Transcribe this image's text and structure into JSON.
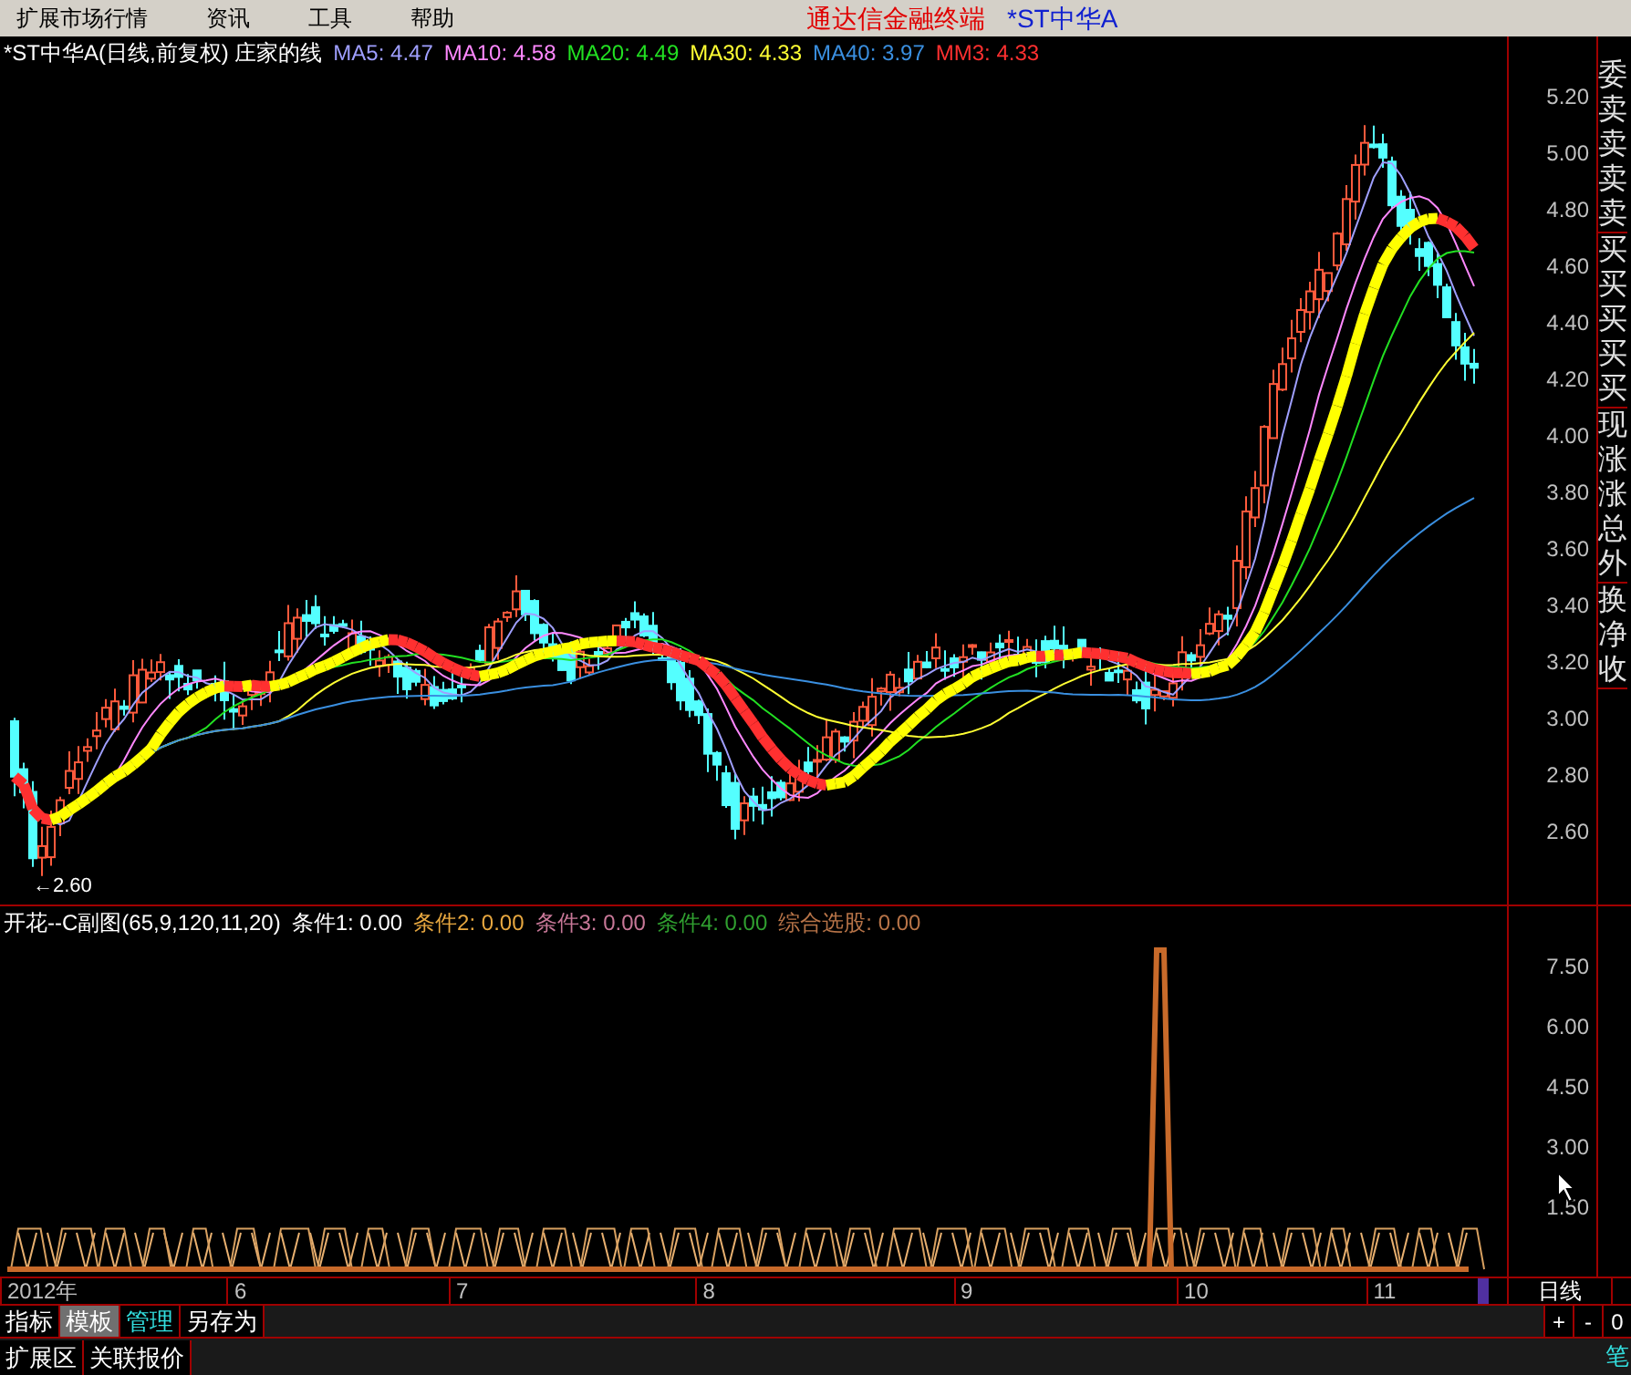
{
  "menu": [
    {
      "label": "扩展市场行情"
    },
    {
      "label": "资讯"
    },
    {
      "label": "工具"
    },
    {
      "label": "帮助"
    }
  ],
  "terminal_title": "通达信金融终端",
  "stock": "*ST中华A",
  "main_chart": {
    "title": "*ST中华A(日线,前复权) 庄家的线",
    "indicators": [
      {
        "label": "MA5: 4.47",
        "color": "#9f9fff"
      },
      {
        "label": "MA10: 4.58",
        "color": "#ff88ff"
      },
      {
        "label": "MA20: 4.49",
        "color": "#22e022"
      },
      {
        "label": "MA30: 4.33",
        "color": "#ffff33"
      },
      {
        "label": "MA40: 3.97",
        "color": "#3a8fe0"
      },
      {
        "label": "MM3: 4.33",
        "color": "#ff3030"
      }
    ],
    "low_marker": "←2.60",
    "y_axis": [
      "5.20",
      "5.00",
      "4.80",
      "4.60",
      "4.40",
      "4.20",
      "4.00",
      "3.80",
      "3.60",
      "3.40",
      "3.20",
      "3.00",
      "2.80",
      "2.60"
    ]
  },
  "side_panel": [
    {
      "text": "委卖卖卖卖"
    },
    {
      "text": "买买买买买"
    },
    {
      "text": "现涨涨总外"
    },
    {
      "text": "换净收"
    }
  ],
  "sub_chart": {
    "title": "开花--C副图(65,9,120,11,20)",
    "indicators": [
      {
        "label": "条件1: 0.00",
        "color": "#ffffff"
      },
      {
        "label": "条件2: 0.00",
        "color": "#e8a840"
      },
      {
        "label": "条件3: 0.00",
        "color": "#c87898"
      },
      {
        "label": "条件4: 0.00",
        "color": "#30a030"
      },
      {
        "label": "综合选股: 0.00",
        "color": "#b87448"
      }
    ],
    "y_axis": [
      "7.50",
      "6.00",
      "4.50",
      "3.00",
      "1.50"
    ]
  },
  "time_axis": {
    "labels": [
      "2012年",
      "6",
      "7",
      "8",
      "9",
      "10",
      "11"
    ],
    "period": "日线"
  },
  "tabs": [
    {
      "label": "指标",
      "selected": false,
      "highlighted": false
    },
    {
      "label": "模板",
      "selected": true,
      "highlighted": false
    },
    {
      "label": "管理",
      "selected": false,
      "highlighted": true
    },
    {
      "label": "另存为",
      "selected": false,
      "highlighted": false
    }
  ],
  "zoom_buttons": [
    "+",
    "-",
    "0"
  ],
  "bottom_tabs": [
    "扩展区",
    "关联报价"
  ],
  "corner_label": "笔"
}
